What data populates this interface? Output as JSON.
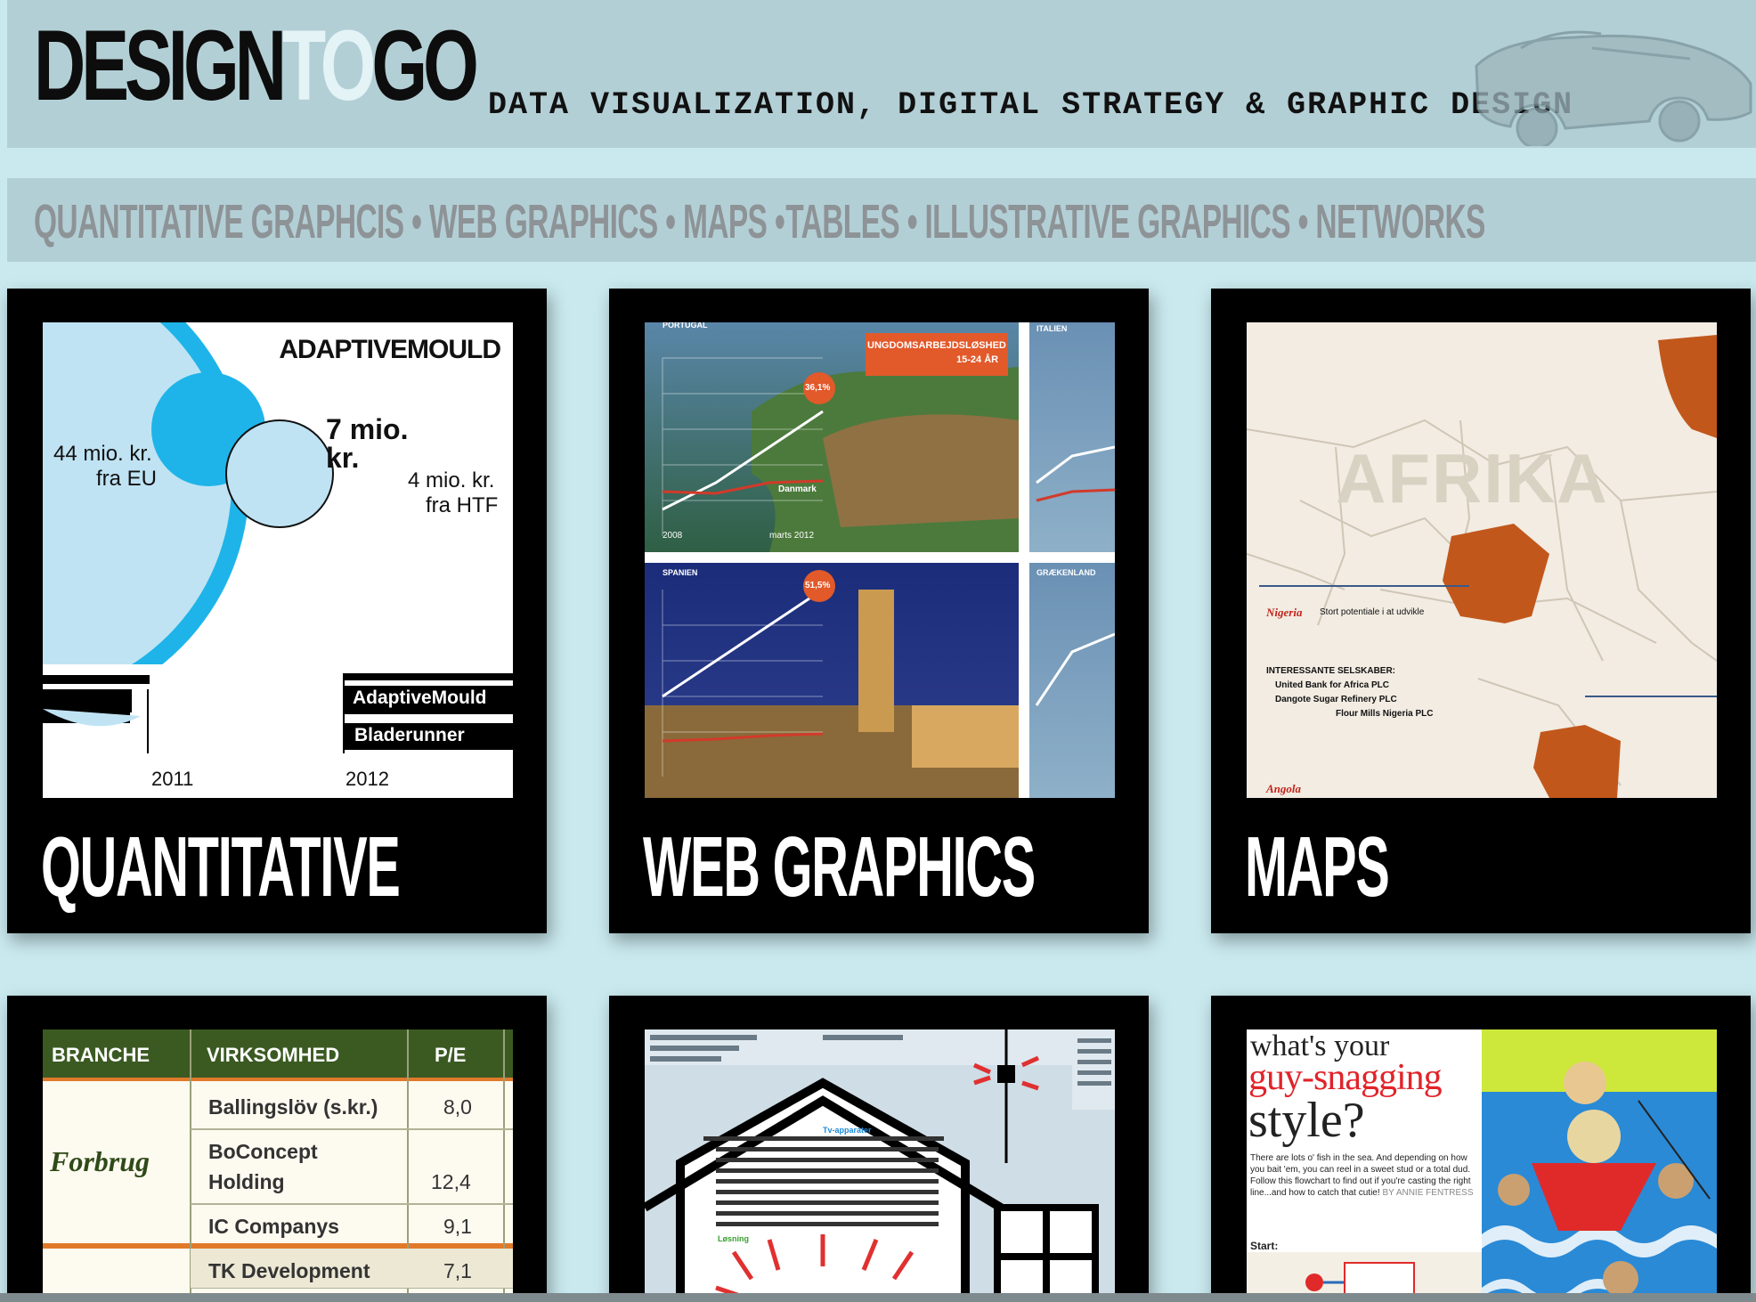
{
  "header": {
    "logo_part1": "DESIGN",
    "logo_part2": "TO",
    "logo_part3": "GO",
    "tagline": "DATA VISUALIZATION, DIGITAL STRATEGY & GRAPHIC DESIGN",
    "car_icon": "vintage-car-icon"
  },
  "nav": {
    "items": [
      "QUANTITATIVE GRAPHCIS",
      "WEB GRAPHICS",
      "MAPS",
      "TABLES",
      "ILLUSTRATIVE GRAPHICS",
      "NETWORKS"
    ],
    "separator": "•"
  },
  "cards": {
    "quantitative": {
      "title": "QUANTITATIVE",
      "heading": "ADAPTIVEMOULD",
      "big_label_1": "44 mio. kr.",
      "big_label_2": "fra EU",
      "mid_label_1": "7 mio.",
      "mid_label_2": "kr.",
      "small_label_1": "4 mio. kr.",
      "small_label_2": "fra HTF",
      "legend_1": "AdaptiveMould",
      "legend_2": "Bladerunner",
      "year_1": "2011",
      "year_2": "2012"
    },
    "web": {
      "title": "WEB GRAPHICS",
      "badge_title": "UNGDOMSARBEJDSLØSHED",
      "badge_sub": "15-24 ÅR",
      "panel_1": "PORTUGAL",
      "panel_2": "ITALIEN",
      "panel_3": "SPANIEN",
      "panel_4": "GRÆKENLAND",
      "value_1": "36,1%",
      "value_2": "51,5%",
      "line_label": "Danmark",
      "date_start": "2008",
      "date_end": "marts 2012"
    },
    "maps": {
      "title": "MAPS",
      "map_label": "AFRIKA",
      "country_1": "Nigeria",
      "country_2": "Angola",
      "text_1": "Stort potentiale i at udvikle",
      "text_2": "INTERESSANTE SELSKABER:",
      "text_3": "United Bank for Africa PLC",
      "text_4": "Dangote Sugar Refinery PLC",
      "text_5": "Flour Mills Nigeria PLC"
    },
    "tables": {
      "headers": [
        "BRANCHE",
        "VIRKSOMHED",
        "P/E"
      ],
      "sector": "Forbrug",
      "rows": [
        {
          "company": "Ballingslöv (s.kr.)",
          "pe": "8,0"
        },
        {
          "company_1": "BoConcept",
          "company_2": "Holding",
          "pe": "12,4"
        },
        {
          "company": "IC Companys",
          "pe": "9,1"
        },
        {
          "company": "TK Development",
          "pe": "7,1"
        }
      ]
    },
    "illustrative": {
      "highlight": "Tv-apparater",
      "highlight_2": "Løsning"
    },
    "networks": {
      "headline_1": "what's your",
      "headline_2": "guy-snagging",
      "headline_3": "style?",
      "body": "There are lots o' fish in the sea. And depending on how you bait 'em, you can reel in a sweet stud or a total dud. Follow this flowchart to find out if you're casting the right line...and how to catch that cutie!",
      "byline": "BY ANNIE FENTRESS",
      "start": "Start:"
    }
  }
}
